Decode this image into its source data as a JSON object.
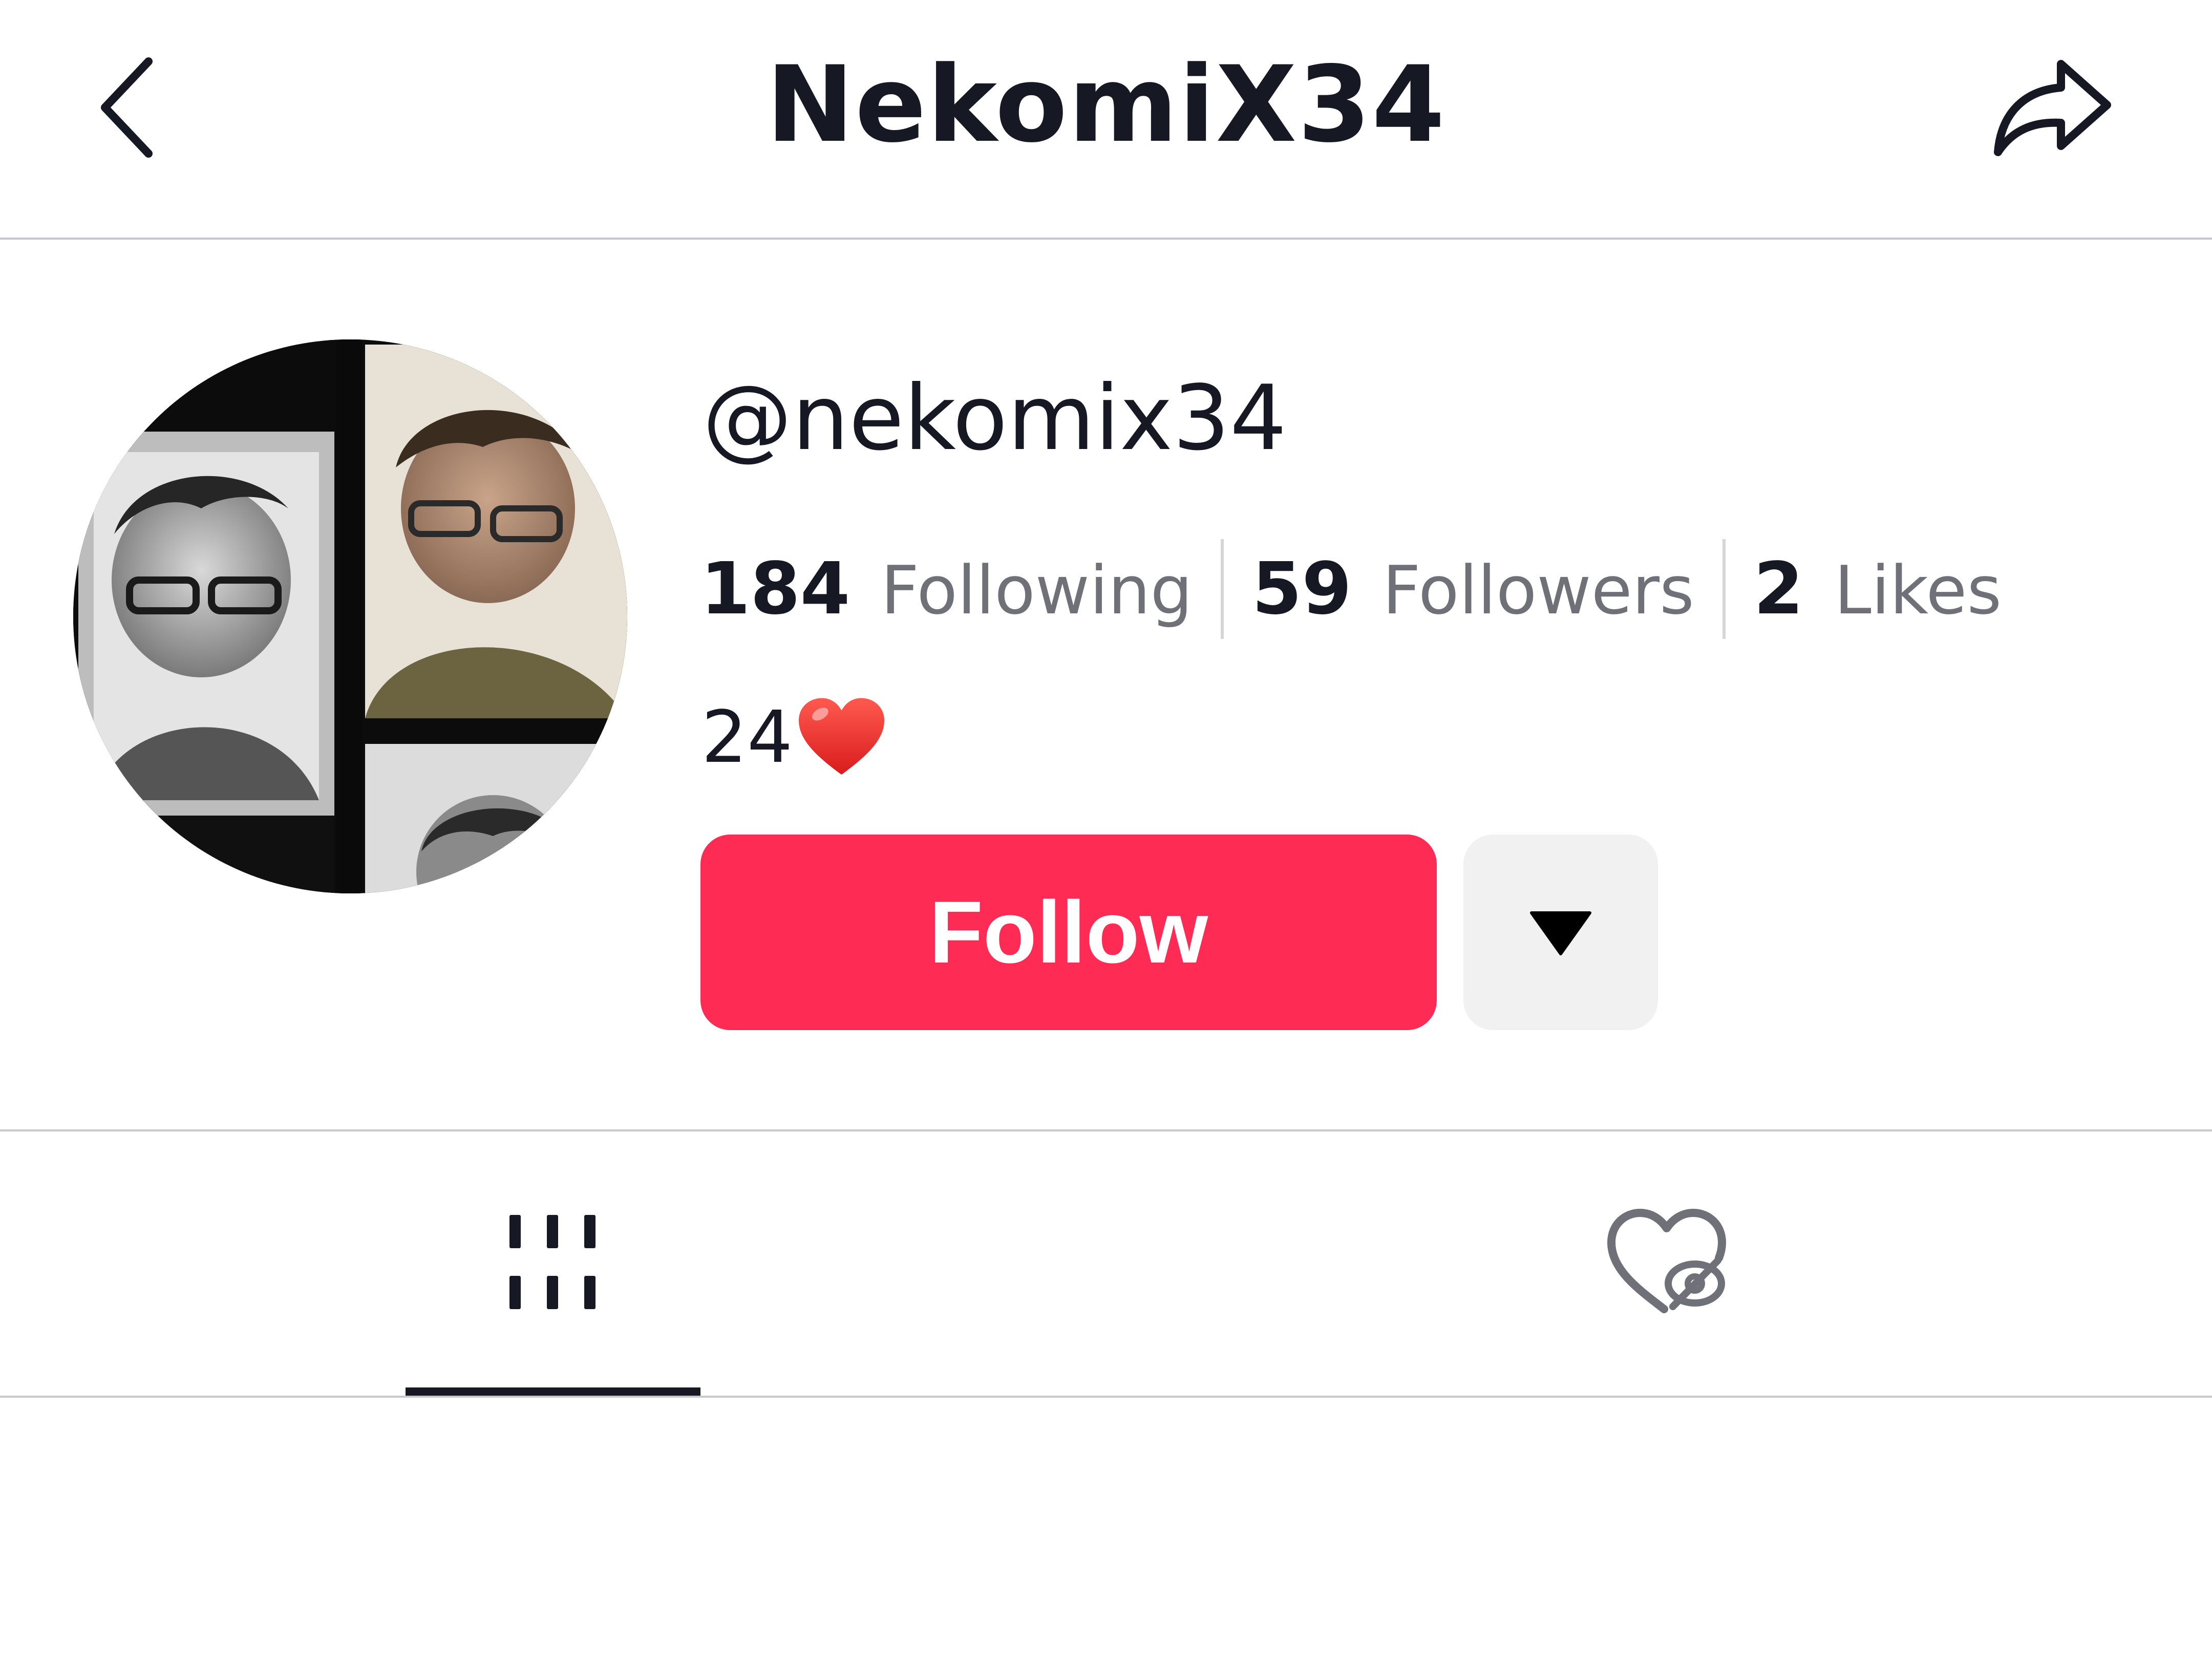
{
  "header": {
    "title": "NekomiX34",
    "back_icon": "chevron-left-icon",
    "share_icon": "share-arrow-icon"
  },
  "profile": {
    "username": "@nekomix34",
    "stats": {
      "following_count": "184",
      "following_label": "Following",
      "followers_count": "59",
      "followers_label": "Followers",
      "likes_count": "2",
      "likes_label": "Likes"
    },
    "bio": "24",
    "bio_emoji": "red-heart-emoji"
  },
  "actions": {
    "follow_label": "Follow",
    "more_icon": "triangle-down-icon"
  },
  "tabs": [
    {
      "name": "videos",
      "icon": "grid-icon",
      "selected": true
    },
    {
      "name": "liked",
      "icon": "heart-hidden-icon",
      "selected": false
    }
  ],
  "colors": {
    "accent": "#fe2c55",
    "text_primary": "#161823",
    "text_secondary": "#6f7078",
    "divider": "#c8c8cc",
    "secondary_button": "#f1f1f2"
  }
}
